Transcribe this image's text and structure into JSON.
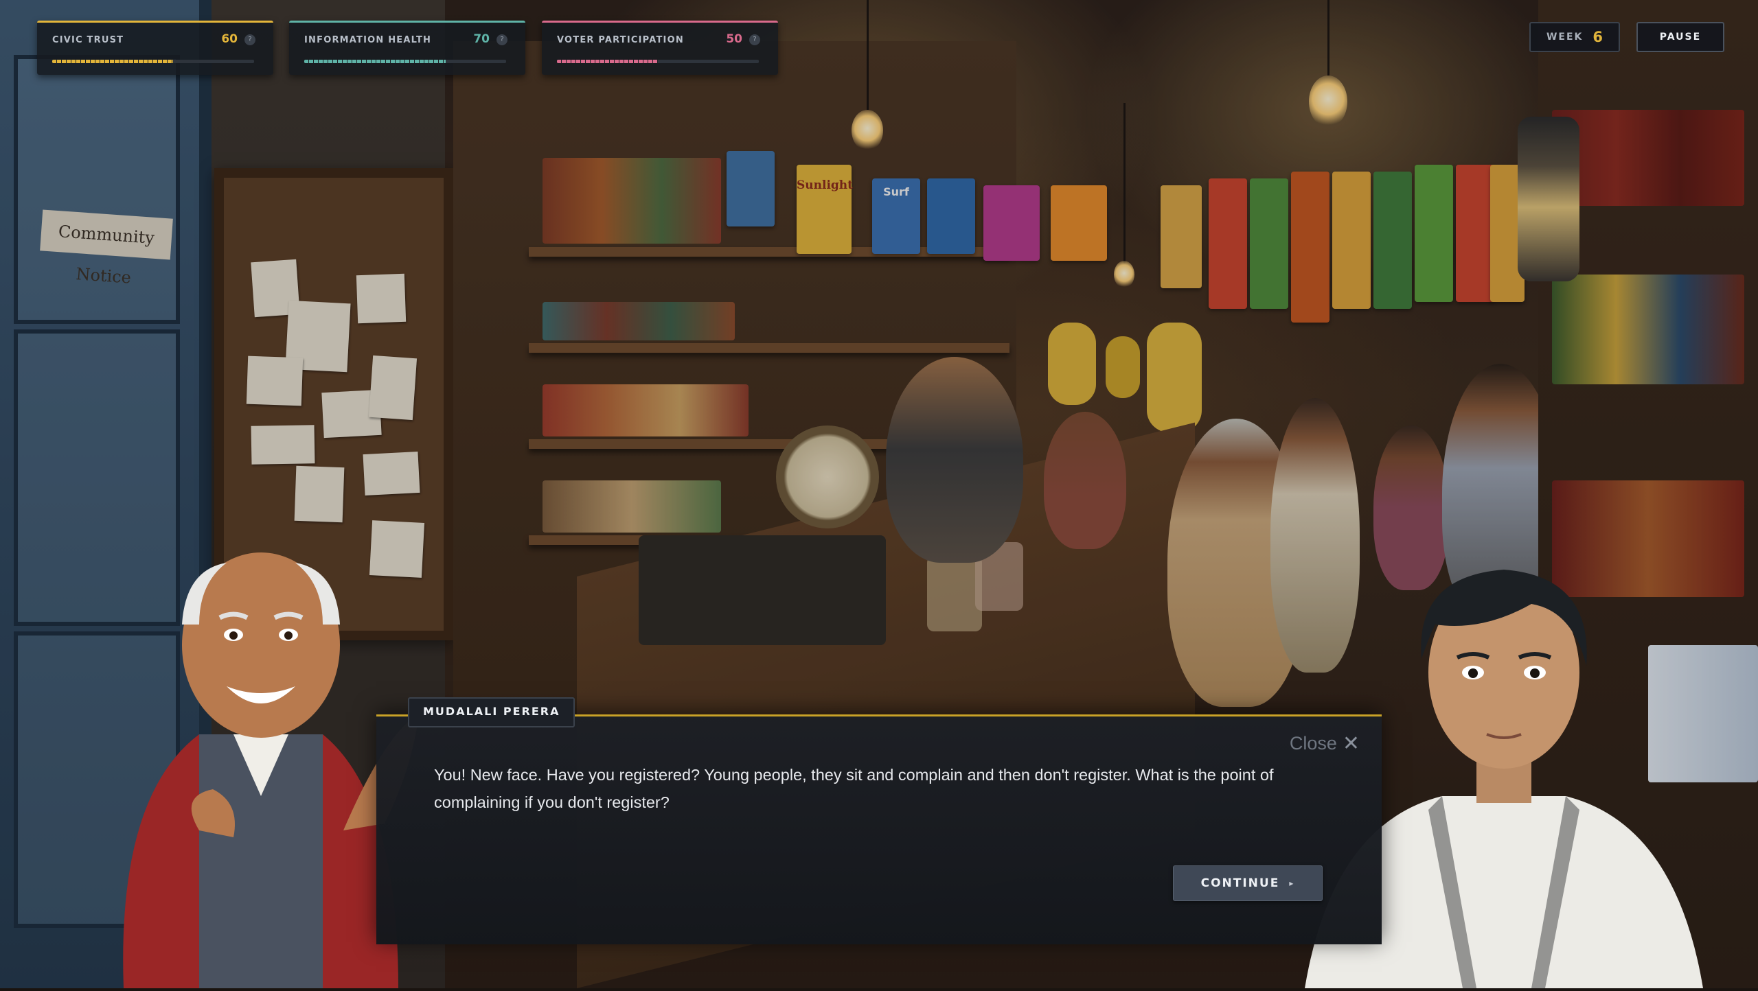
{
  "hud": {
    "stats": [
      {
        "label": "CIVIC TRUST",
        "value": "60",
        "level": 0.6,
        "accent": "#e3b53a",
        "help": "?"
      },
      {
        "label": "INFORMATION HEALTH",
        "value": "70",
        "level": 0.7,
        "accent": "#5fb3a7",
        "help": "?"
      },
      {
        "label": "VOTER PARTICIPATION",
        "value": "50",
        "level": 0.5,
        "accent": "#d96a8c",
        "help": "?"
      }
    ],
    "week_label": "WEEK",
    "week_number": "6",
    "pause_label": "PAUSE"
  },
  "dialog": {
    "speaker": "MUDALALI PERERA",
    "close_label": "Close",
    "close_icon": "close-icon",
    "text": "You! New face. Have you registered? Young people, they sit and complain and then don't register. What is the point of complaining if you don't register?",
    "continue_label": "CONTINUE",
    "continue_icon": "play-arrow-icon"
  },
  "scene": {
    "notice_board_title": "Community Notice",
    "packet_labels": [
      "Sunlight",
      "Surf"
    ]
  },
  "colors": {
    "gold_accent": "#c9a227",
    "panel_bg": "#1c2027",
    "button_bg": "#3f4856"
  }
}
